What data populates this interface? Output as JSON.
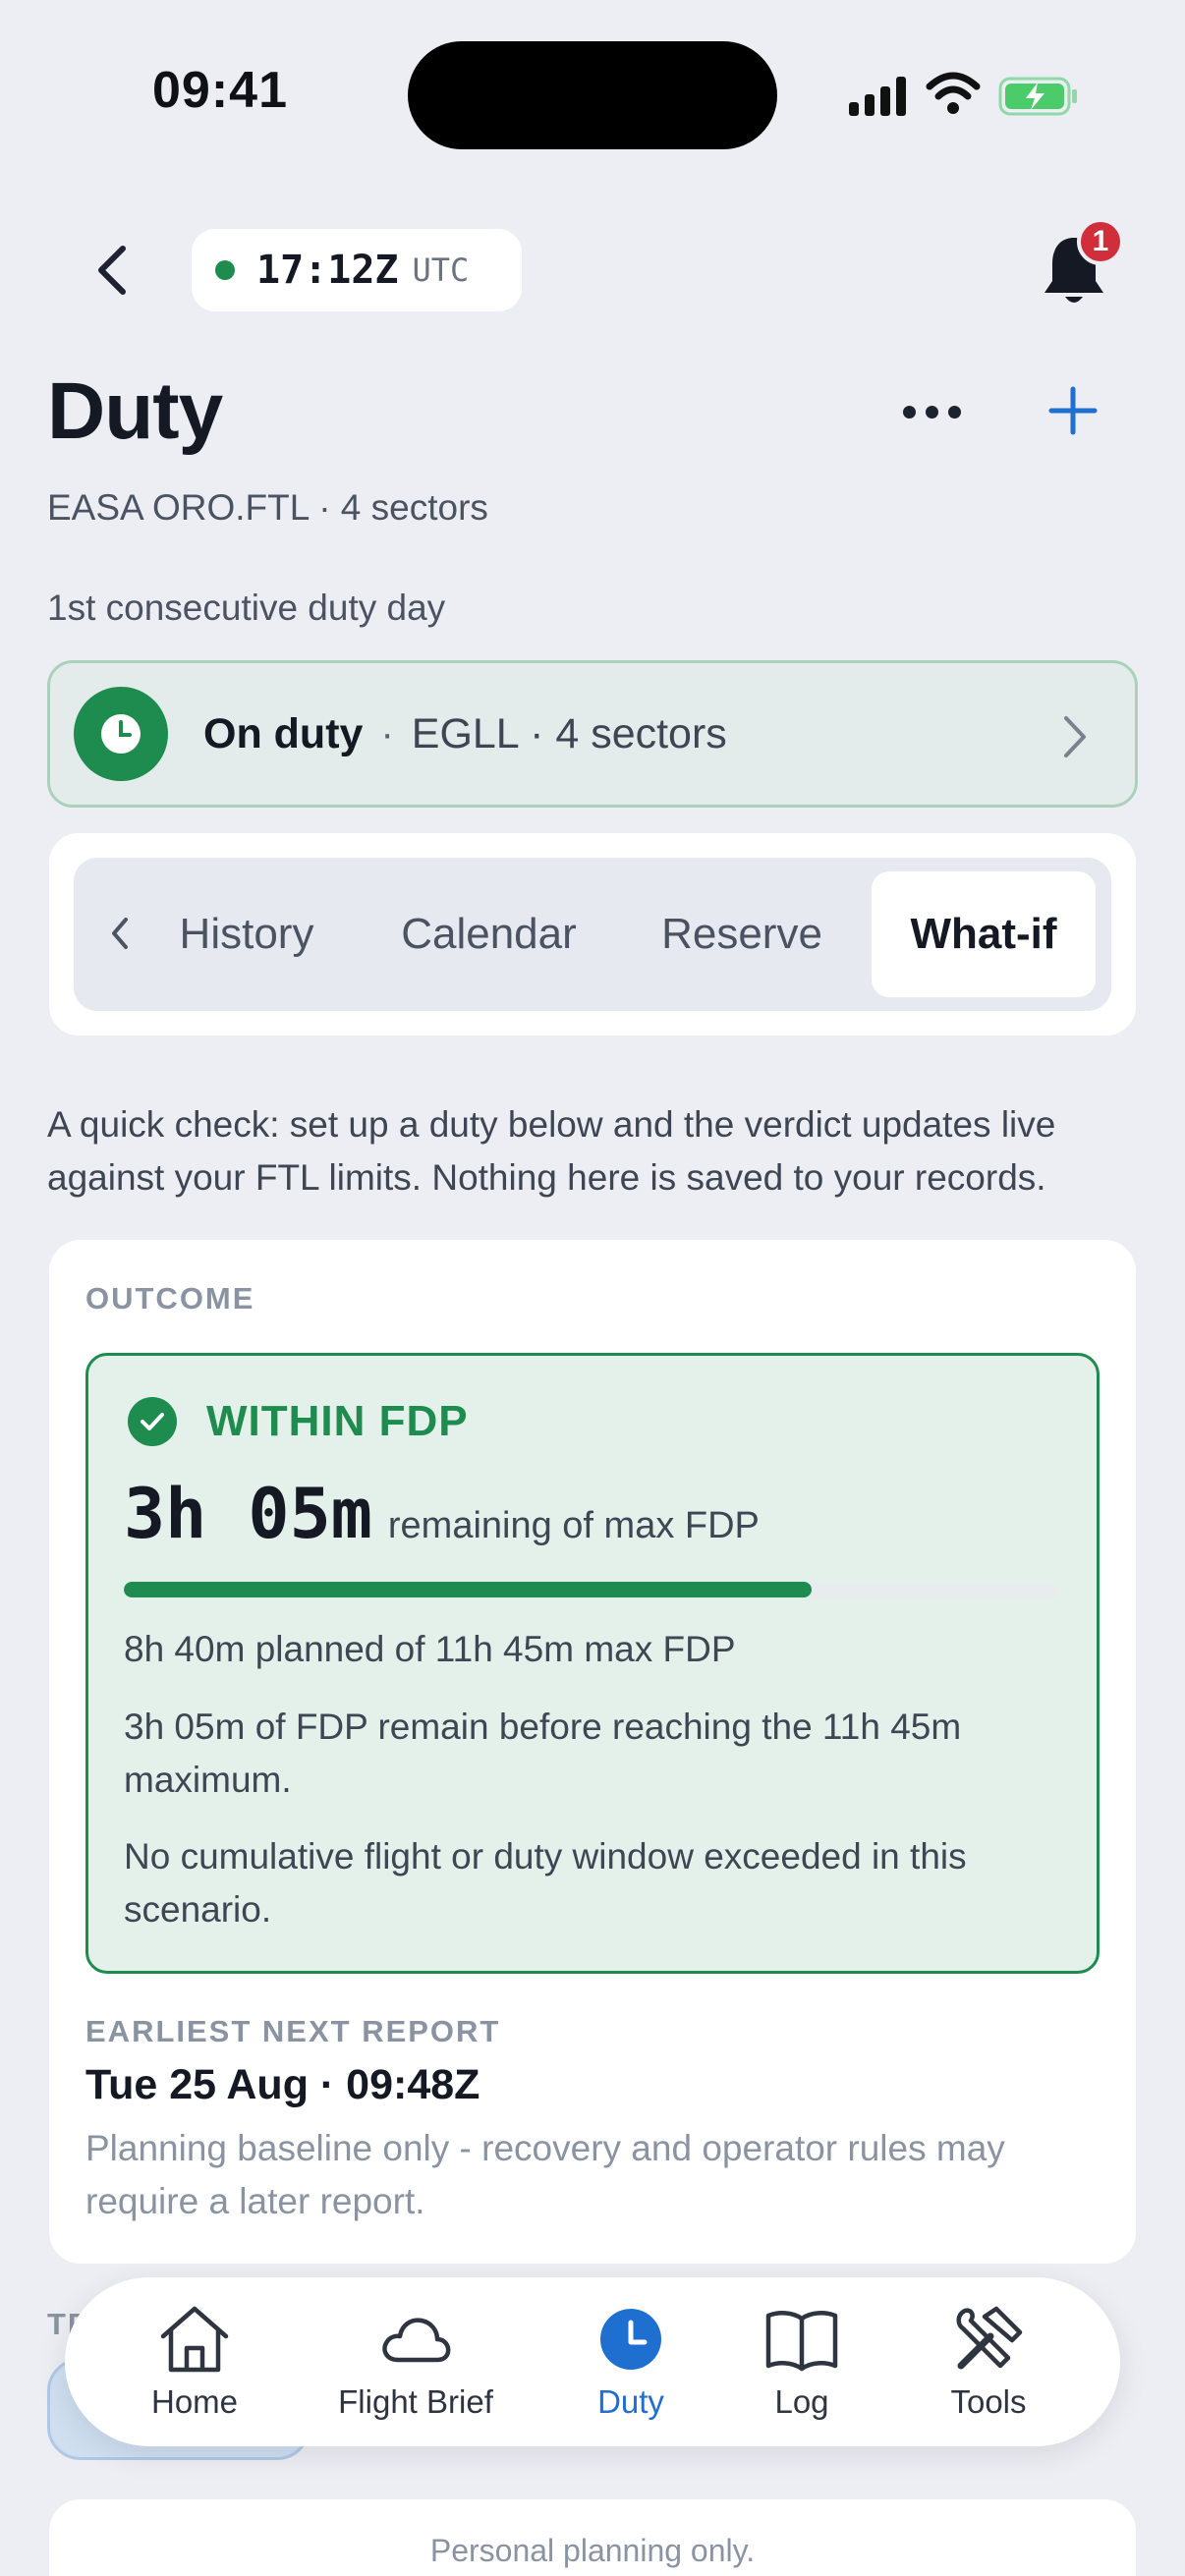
{
  "status_bar": {
    "time": "09:41"
  },
  "header": {
    "utc_time": "17:12Z",
    "utc_label": "UTC",
    "notification_count": "1",
    "title": "Duty",
    "subtitle": "EASA ORO.FTL · 4 sectors",
    "duty_day": "1st consecutive duty day"
  },
  "on_duty": {
    "status": "On duty",
    "separator": "·",
    "detail": "EGLL · 4 sectors"
  },
  "tabs": [
    {
      "label": "History",
      "active": false
    },
    {
      "label": "Calendar",
      "active": false
    },
    {
      "label": "Reserve",
      "active": false
    },
    {
      "label": "What-if",
      "active": true
    }
  ],
  "intro_text": "A quick check: set up a duty below and the verdict updates live against your FTL limits. Nothing here is saved to your records.",
  "outcome": {
    "section_label": "OUTCOME",
    "verdict": "WITHIN FDP",
    "remaining_value": "3h 05m",
    "remaining_label": "remaining of max FDP",
    "fdp_used_fraction": 0.737,
    "lines": [
      "8h 40m planned of 11h 45m max FDP",
      "3h 05m of FDP remain before reaching the 11h 45m maximum.",
      "No cumulative flight or duty window exceeded in this scenario."
    ],
    "next_report_label": "EARLIEST NEXT REPORT",
    "next_report_value": "Tue 25 Aug · 09:48Z",
    "next_report_note": "Planning baseline only - recovery and operator rules may require a later report."
  },
  "partial_section_label": "TR",
  "bottom_nav": [
    {
      "label": "Home",
      "icon": "home-icon",
      "active": false
    },
    {
      "label": "Flight Brief",
      "icon": "cloud-icon",
      "active": false
    },
    {
      "label": "Duty",
      "icon": "clock-icon",
      "active": true
    },
    {
      "label": "Log",
      "icon": "book-icon",
      "active": false
    },
    {
      "label": "Tools",
      "icon": "tools-icon",
      "active": false
    }
  ],
  "footer_note": "Personal planning only.",
  "colors": {
    "accent_green": "#1E8C4E",
    "accent_blue": "#1F6FD1",
    "badge_red": "#D12E3B",
    "background": "#ECEEF3"
  }
}
